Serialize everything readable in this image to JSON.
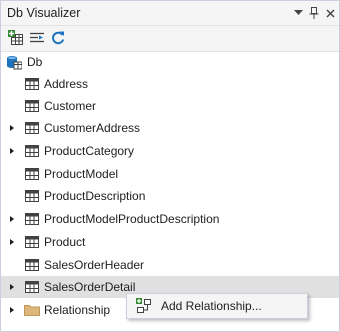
{
  "window": {
    "title": "Db Visualizer",
    "dropdown_icon": "dropdown-arrow-icon",
    "pin_icon": "pin-icon",
    "close_icon": "close-icon"
  },
  "toolbar": {
    "buttons": [
      "add-table-icon",
      "filter-icon",
      "refresh-icon"
    ]
  },
  "tree": {
    "root": "Db",
    "items": [
      {
        "label": "Address",
        "expandable": false
      },
      {
        "label": "Customer",
        "expandable": false
      },
      {
        "label": "CustomerAddress",
        "expandable": true
      },
      {
        "label": "ProductCategory",
        "expandable": true
      },
      {
        "label": "ProductModel",
        "expandable": false
      },
      {
        "label": "ProductDescription",
        "expandable": false
      },
      {
        "label": "ProductModelProductDescription",
        "expandable": true
      },
      {
        "label": "Product",
        "expandable": true
      },
      {
        "label": "SalesOrderHeader",
        "expandable": false
      },
      {
        "label": "SalesOrderDetail",
        "expandable": true,
        "hovered": true
      }
    ],
    "folder": {
      "label": "Relationship",
      "expandable": true
    }
  },
  "context_menu": {
    "items": [
      {
        "label": "Add Relationship...",
        "icon": "add-relationship-icon"
      }
    ]
  },
  "colors": {
    "titlebar_bg": "#f5f5f5",
    "hover_bg": "#e0e0e0",
    "icon_blue": "#1e73be",
    "folder": "#dcb67a",
    "table_icon": "#424242"
  }
}
